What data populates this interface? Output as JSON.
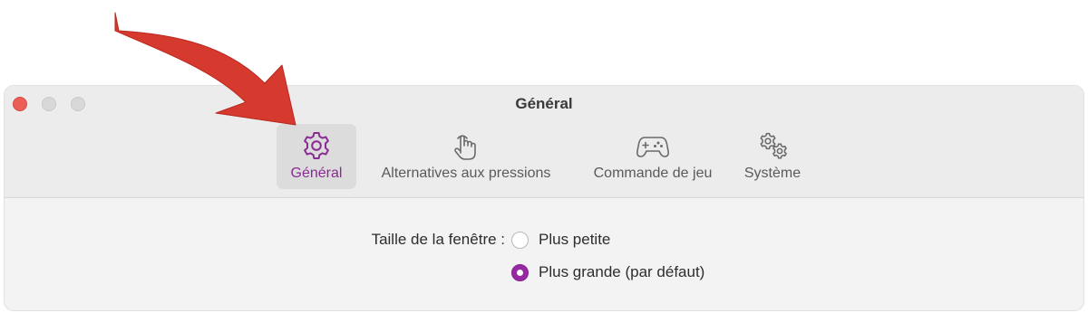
{
  "window": {
    "title": "Général"
  },
  "toolbar": {
    "tabs": [
      {
        "label": "Général",
        "icon": "gear-icon",
        "selected": true
      },
      {
        "label": "Alternatives aux pressions",
        "icon": "hand-tap-icon",
        "selected": false
      },
      {
        "label": "Commande de jeu",
        "icon": "gamepad-icon",
        "selected": false
      },
      {
        "label": "Système",
        "icon": "gears-icon",
        "selected": false
      }
    ]
  },
  "settings": {
    "window_size_label": "Taille de la fenêtre :",
    "options": [
      {
        "label": "Plus petite",
        "selected": false
      },
      {
        "label": "Plus grande (par défaut)",
        "selected": true
      }
    ]
  },
  "colors": {
    "accent": "#972aa3",
    "annotation_arrow": "#d63a2e",
    "close_button": "#ec5f57"
  }
}
